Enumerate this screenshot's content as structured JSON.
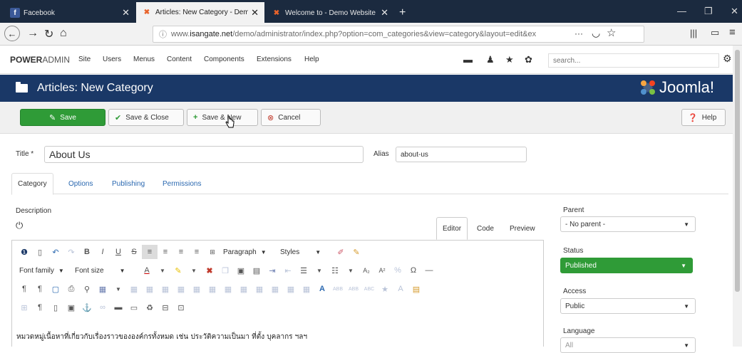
{
  "browser": {
    "tabs": [
      {
        "label": "Facebook",
        "icon": "facebook-icon"
      },
      {
        "label": "Articles: New Category - Demo",
        "icon": "joomla-icon"
      },
      {
        "label": "Welcome to - Demo Website",
        "icon": "joomla-icon"
      }
    ],
    "new_tab": "+",
    "url_prefix": "www.",
    "url_domain": "isangate.net",
    "url_path": "/demo/administrator/index.php?option=com_categories&view=category&layout=edit&ex",
    "url_more": "···"
  },
  "admin": {
    "brand_bold": "POWER",
    "brand_rest": "ADMIN",
    "menu": [
      "Site",
      "Users",
      "Menus",
      "Content",
      "Components",
      "Extensions",
      "Help"
    ],
    "search_placeholder": "search..."
  },
  "page": {
    "title": "Articles: New Category",
    "logo_text": "Joomla!"
  },
  "toolbar": {
    "save": "Save",
    "save_close": "Save & Close",
    "save_new": "Save & New",
    "cancel": "Cancel",
    "help": "Help"
  },
  "form": {
    "title_label": "Title *",
    "title_value": "About Us",
    "alias_label": "Alias",
    "alias_value": "about-us",
    "tabs": [
      "Category",
      "Options",
      "Publishing",
      "Permissions"
    ],
    "description_label": "Description",
    "editor_tabs": [
      "Editor",
      "Code",
      "Preview"
    ],
    "format_select": "Paragraph",
    "styles_select": "Styles",
    "font_family": "Font family",
    "font_size": "Font size",
    "content_text": "หมวดหมู่เนื้อหาที่เกี่ยวกับเรื่องราวขององค์กรทั้งหมด เช่น ประวัติความเป็นมา ที่ตั้ง บุคลากร ฯลฯ"
  },
  "sidebar": {
    "parent_label": "Parent",
    "parent_value": "- No parent -",
    "status_label": "Status",
    "status_value": "Published",
    "access_label": "Access",
    "access_value": "Public",
    "language_label": "Language",
    "language_value": "All"
  },
  "colors": {
    "title_bar": "#1a3867",
    "save_green": "#2f9b37",
    "tab_bar": "#1b2a3f",
    "link_blue": "#2a68b0"
  }
}
